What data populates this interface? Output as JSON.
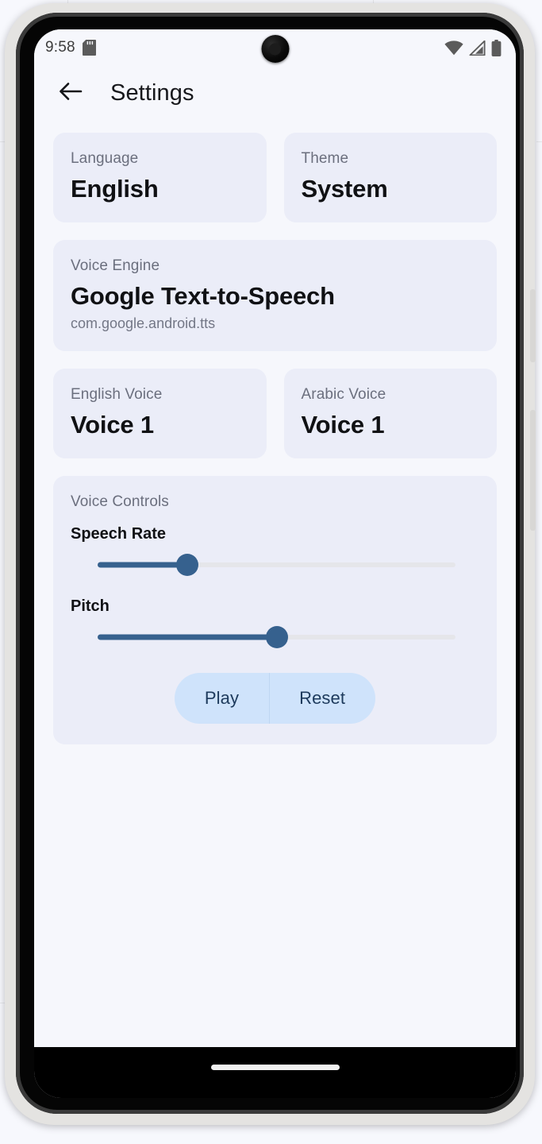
{
  "status_bar": {
    "time": "9:58",
    "icons": {
      "sd_card": "sd-card-icon",
      "wifi": "wifi-icon",
      "cellular": "cellular-signal-icon",
      "battery": "battery-icon"
    }
  },
  "app_bar": {
    "back_icon": "back-arrow-icon",
    "title": "Settings"
  },
  "settings": {
    "language": {
      "label": "Language",
      "value": "English"
    },
    "theme": {
      "label": "Theme",
      "value": "System"
    },
    "voice_engine": {
      "label": "Voice Engine",
      "value": "Google Text-to-Speech",
      "package": "com.google.android.tts"
    },
    "english_voice": {
      "label": "English Voice",
      "value": "Voice 1"
    },
    "arabic_voice": {
      "label": "Arabic Voice",
      "value": "Voice 1"
    },
    "voice_controls": {
      "label": "Voice Controls",
      "speech_rate": {
        "label": "Speech Rate",
        "percent": 25
      },
      "pitch": {
        "label": "Pitch",
        "percent": 50
      },
      "play_label": "Play",
      "reset_label": "Reset"
    }
  },
  "colors": {
    "screen_background": "#f6f7fc",
    "card_background": "#ebedf8",
    "slider_active": "#36618e",
    "slider_inactive": "#e5e6ea",
    "button_background": "#cfe3fb",
    "button_text": "#1d3a5c",
    "label_text": "#6b6f7e",
    "value_text": "#101114"
  },
  "nav_bar": {
    "gesture_pill": "gesture-pill"
  }
}
